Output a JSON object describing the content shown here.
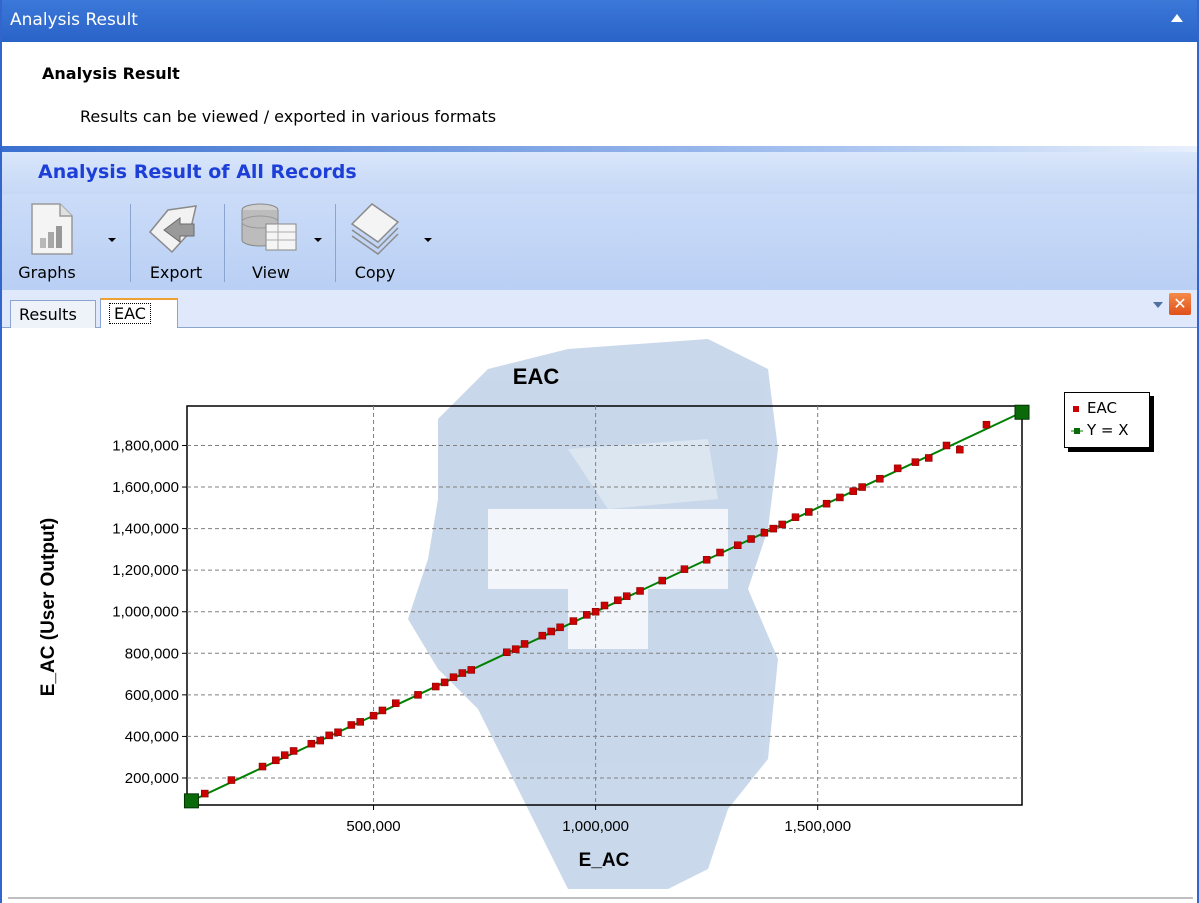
{
  "window": {
    "title": "Analysis Result"
  },
  "header": {
    "title": "Analysis Result",
    "subtitle": "Results can be viewed / exported in various formats"
  },
  "section": {
    "title": "Analysis Result of All Records"
  },
  "toolbar": {
    "graphs_label": "Graphs",
    "export_label": "Export",
    "view_label": "View",
    "copy_label": "Copy"
  },
  "tabs": {
    "results": "Results",
    "eac": "EAC"
  },
  "icons": {
    "collapse": "chevron-up-icon",
    "graphs": "chart-document-icon",
    "export": "export-arrow-icon",
    "view": "database-table-icon",
    "copy": "copy-pages-icon",
    "tab_menu": "chevron-down-icon",
    "close": "close-icon"
  },
  "colors": {
    "eac_series": "#cc0000",
    "yx_series": "#008000",
    "title_bar": "#2a63c8",
    "section_title": "#1d3fd8"
  },
  "chart_data": {
    "type": "scatter",
    "title": "EAC",
    "xlabel": "E_AC",
    "ylabel": "E_AC (User Output)",
    "xlim": [
      80000,
      1960000
    ],
    "ylim": [
      70000,
      1990000
    ],
    "x_ticks": [
      500000,
      1000000,
      1500000
    ],
    "x_tick_labels": [
      "500,000",
      "1,000,000",
      "1,500,000"
    ],
    "y_ticks": [
      200000,
      400000,
      600000,
      800000,
      1000000,
      1200000,
      1400000,
      1600000,
      1800000
    ],
    "y_tick_labels": [
      "200,000",
      "400,000",
      "600,000",
      "800,000",
      "1,000,000",
      "1,200,000",
      "1,400,000",
      "1,600,000",
      "1,800,000"
    ],
    "grid": true,
    "legend_position": "top-right",
    "series": [
      {
        "name": "EAC",
        "points": [
          [
            120000,
            125000
          ],
          [
            180000,
            190000
          ],
          [
            250000,
            255000
          ],
          [
            280000,
            285000
          ],
          [
            300000,
            310000
          ],
          [
            320000,
            330000
          ],
          [
            360000,
            365000
          ],
          [
            380000,
            380000
          ],
          [
            400000,
            405000
          ],
          [
            420000,
            420000
          ],
          [
            450000,
            455000
          ],
          [
            470000,
            470000
          ],
          [
            500000,
            500000
          ],
          [
            520000,
            525000
          ],
          [
            550000,
            560000
          ],
          [
            600000,
            600000
          ],
          [
            640000,
            640000
          ],
          [
            660000,
            660000
          ],
          [
            680000,
            685000
          ],
          [
            700000,
            705000
          ],
          [
            720000,
            720000
          ],
          [
            800000,
            805000
          ],
          [
            820000,
            820000
          ],
          [
            840000,
            845000
          ],
          [
            880000,
            885000
          ],
          [
            900000,
            905000
          ],
          [
            920000,
            925000
          ],
          [
            950000,
            955000
          ],
          [
            980000,
            985000
          ],
          [
            1000000,
            1000000
          ],
          [
            1020000,
            1030000
          ],
          [
            1050000,
            1055000
          ],
          [
            1070000,
            1075000
          ],
          [
            1100000,
            1100000
          ],
          [
            1150000,
            1150000
          ],
          [
            1200000,
            1205000
          ],
          [
            1250000,
            1250000
          ],
          [
            1280000,
            1285000
          ],
          [
            1320000,
            1320000
          ],
          [
            1350000,
            1350000
          ],
          [
            1380000,
            1380000
          ],
          [
            1400000,
            1400000
          ],
          [
            1420000,
            1420000
          ],
          [
            1450000,
            1455000
          ],
          [
            1480000,
            1480000
          ],
          [
            1520000,
            1520000
          ],
          [
            1550000,
            1550000
          ],
          [
            1580000,
            1580000
          ],
          [
            1600000,
            1600000
          ],
          [
            1640000,
            1640000
          ],
          [
            1680000,
            1690000
          ],
          [
            1720000,
            1720000
          ],
          [
            1750000,
            1740000
          ],
          [
            1790000,
            1800000
          ],
          [
            1820000,
            1780000
          ],
          [
            1880000,
            1900000
          ]
        ]
      },
      {
        "name": "Y = X",
        "points": [
          [
            90000,
            90000
          ],
          [
            1960000,
            1960000
          ]
        ]
      }
    ]
  }
}
